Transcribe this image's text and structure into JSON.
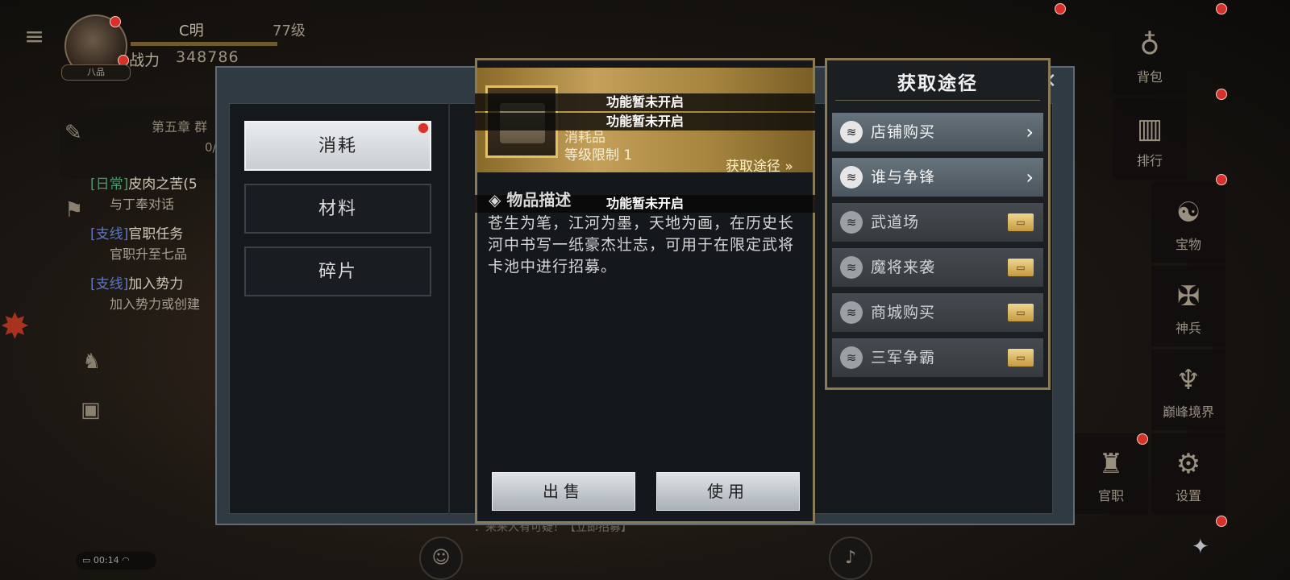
{
  "player": {
    "name": "C明",
    "level": "77级",
    "power_label": "战力",
    "power_value": "348786",
    "badge": "八品"
  },
  "quests": {
    "chapter": "第五章 群",
    "progress": "0/",
    "items": [
      {
        "tag": "[日常]",
        "title": "皮肉之苦(5",
        "sub": "与丁奉对话"
      },
      {
        "tag": "[支线]",
        "title": "官职任务",
        "sub": "官职升至七品"
      },
      {
        "tag": "[支线]",
        "title": "加入势力",
        "sub": "加入势力或创建"
      }
    ]
  },
  "right_menu": [
    {
      "label": "背包",
      "icon": "bag-icon"
    },
    {
      "label": "排行",
      "icon": "ranking-icon"
    },
    {
      "label": "宝物",
      "icon": "treasure-icon"
    },
    {
      "label": "神兵",
      "icon": "weapon-icon"
    },
    {
      "label": "巅峰境界",
      "icon": "peak-icon"
    },
    {
      "label": "官职",
      "icon": "official-icon"
    },
    {
      "label": "设置",
      "icon": "settings-icon"
    }
  ],
  "status": {
    "time": "00:14"
  },
  "chat": {
    "text": "：来来人有可疑！【立即招募】"
  },
  "inventory": {
    "tabs": [
      {
        "label": "消耗",
        "active": true
      },
      {
        "label": "材料",
        "active": false
      },
      {
        "label": "碎片",
        "active": false
      }
    ]
  },
  "item": {
    "type": "消耗品",
    "level_limit": "等级限制 1",
    "get_path_link": "获取途径 »",
    "toasts": [
      "功能暂未开启",
      "功能暂未开启",
      "功能暂未开启"
    ],
    "desc_title": "物品描述",
    "desc_body": "苍生为笔，江河为墨，天地为画，在历史长河中书写一纸豪杰壮志，可用于在限定武将卡池中进行招募。",
    "sell_label": "出售",
    "use_label": "使用"
  },
  "routes": {
    "title": "获取途径",
    "items": [
      {
        "label": "店铺购买",
        "state": "open"
      },
      {
        "label": "谁与争锋",
        "state": "open"
      },
      {
        "label": "武道场",
        "state": "locked"
      },
      {
        "label": "魔将来袭",
        "state": "locked"
      },
      {
        "label": "商城购买",
        "state": "locked"
      },
      {
        "label": "三军争霸",
        "state": "locked"
      }
    ]
  }
}
